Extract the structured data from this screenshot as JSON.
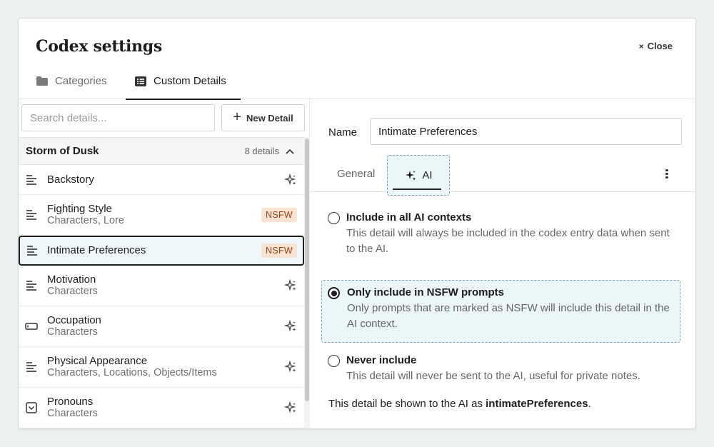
{
  "dialog": {
    "title": "Codex settings",
    "close_label": "Close"
  },
  "tabs": [
    {
      "label": "Categories",
      "icon": "folder-icon",
      "active": false
    },
    {
      "label": "Custom Details",
      "icon": "list-icon",
      "active": true
    }
  ],
  "sidebar": {
    "search_placeholder": "Search details...",
    "new_button": "New Detail",
    "group": {
      "name": "Storm of Dusk",
      "count": "8 details"
    },
    "items": [
      {
        "name": "Backstory",
        "sub": "",
        "icon": "text-lines-icon",
        "badge": ""
      },
      {
        "name": "Fighting Style",
        "sub": "Characters, Lore",
        "icon": "text-lines-icon",
        "badge": "NSFW"
      },
      {
        "name": "Intimate Preferences",
        "sub": "",
        "icon": "text-lines-icon",
        "badge": "NSFW"
      },
      {
        "name": "Motivation",
        "sub": "Characters",
        "icon": "text-lines-icon",
        "badge": ""
      },
      {
        "name": "Occupation",
        "sub": "Characters",
        "icon": "text-field-icon",
        "badge": ""
      },
      {
        "name": "Physical Appearance",
        "sub": "Characters, Locations, Objects/Items",
        "icon": "text-lines-icon",
        "badge": ""
      },
      {
        "name": "Pronouns",
        "sub": "Characters",
        "icon": "dropdown-select-icon",
        "badge": ""
      }
    ]
  },
  "detail": {
    "name_label": "Name",
    "name_value": "Intimate Preferences",
    "subtabs": [
      {
        "label": "General",
        "active": false
      },
      {
        "label": "AI",
        "active": true
      }
    ],
    "options": [
      {
        "label": "Include in all AI contexts",
        "desc": "This detail will always be included in the codex entry data when sent to the AI.",
        "selected": false
      },
      {
        "label": "Only include in NSFW prompts",
        "desc": "Only prompts that are marked as NSFW will include this detail in the AI context.",
        "selected": true
      },
      {
        "label": "Never include",
        "desc": "This detail will never be sent to the AI, useful for private notes.",
        "selected": false
      }
    ],
    "footnote_prefix": "This detail be shown to the AI as ",
    "footnote_key": "intimatePreferences",
    "footnote_suffix": "."
  },
  "colors": {
    "selected_bg": "#eef8fa",
    "badge_bg": "#fbe3d2",
    "badge_text": "#9a3e12"
  }
}
